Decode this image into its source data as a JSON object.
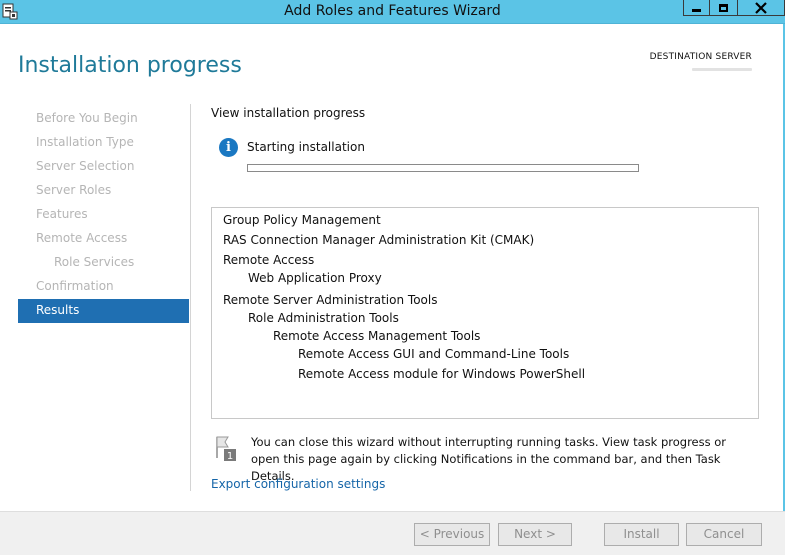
{
  "window": {
    "title": "Add Roles and Features Wizard"
  },
  "header": {
    "page_title": "Installation progress",
    "destination_label": "DESTINATION SERVER"
  },
  "nav": {
    "items": [
      {
        "label": "Before You Begin",
        "state": "disabled"
      },
      {
        "label": "Installation Type",
        "state": "disabled"
      },
      {
        "label": "Server Selection",
        "state": "disabled"
      },
      {
        "label": "Server Roles",
        "state": "disabled"
      },
      {
        "label": "Features",
        "state": "disabled"
      },
      {
        "label": "Remote Access",
        "state": "disabled"
      },
      {
        "label": "Role Services",
        "state": "disabled",
        "sub": true
      },
      {
        "label": "Confirmation",
        "state": "disabled"
      },
      {
        "label": "Results",
        "state": "active"
      }
    ]
  },
  "main": {
    "section_title": "View installation progress",
    "status_text": "Starting installation",
    "progress_fraction": 0,
    "features": [
      {
        "label": "Group Policy Management",
        "level": 0
      },
      {
        "label": "RAS Connection Manager Administration Kit (CMAK)",
        "level": 0
      },
      {
        "label": "Remote Access",
        "level": 0
      },
      {
        "label": "Web Application Proxy",
        "level": 1
      },
      {
        "label": "Remote Server Administration Tools",
        "level": 0
      },
      {
        "label": "Role Administration Tools",
        "level": 1
      },
      {
        "label": "Remote Access Management Tools",
        "level": 2
      },
      {
        "label": "Remote Access GUI and Command-Line Tools",
        "level": 3
      },
      {
        "label": "Remote Access module for Windows PowerShell",
        "level": 3
      }
    ],
    "note_text": "You can close this wizard without interrupting running tasks. View task progress or open this page again by clicking Notifications in the command bar, and then Task Details.",
    "export_link": "Export configuration settings"
  },
  "footer": {
    "previous_label": "< Previous",
    "next_label": "Next >",
    "install_label": "Install",
    "cancel_label": "Cancel"
  },
  "colors": {
    "titlebar": "#5bc4e6",
    "title_accent": "#1f7a99",
    "nav_active": "#1f6fb2",
    "link": "#1565a8"
  },
  "icons": {
    "app": "server-manager-icon",
    "status": "info-icon",
    "note": "flag-notification-icon"
  }
}
